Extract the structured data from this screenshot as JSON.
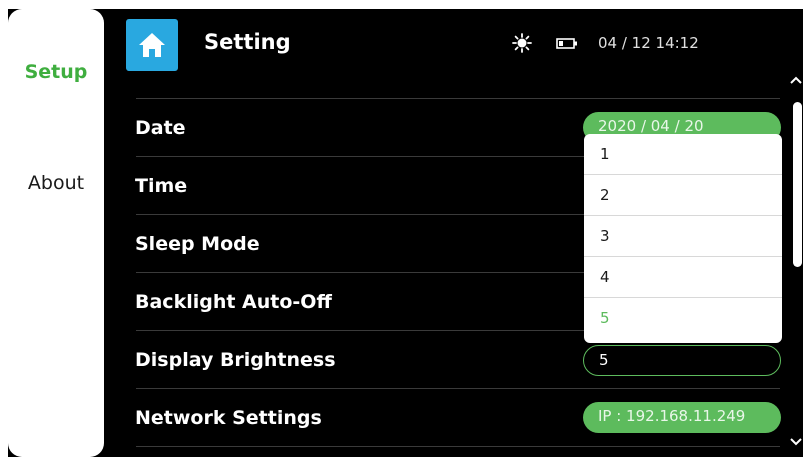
{
  "sidebar": {
    "items": [
      {
        "label": "Setup",
        "active": true
      },
      {
        "label": "About",
        "active": false
      }
    ]
  },
  "header": {
    "title": "Setting",
    "home_icon": "home-icon",
    "status_icons": [
      "brightness-icon",
      "battery-icon"
    ],
    "clock": "04 / 12  14:12"
  },
  "settings": {
    "rows": [
      {
        "label": "Date",
        "value": "2020 / 04 / 20"
      },
      {
        "label": "Time",
        "value": ""
      },
      {
        "label": "Sleep Mode",
        "value": ""
      },
      {
        "label": "Backlight Auto-Off",
        "value": ""
      },
      {
        "label": "Display Brightness",
        "value": "5"
      },
      {
        "label": "Network Settings",
        "value": "IP : 192.168.11.249"
      }
    ]
  },
  "dropdown": {
    "options": [
      "1",
      "2",
      "3",
      "4",
      "5"
    ],
    "selected": "5"
  },
  "colors": {
    "accent": "#5dbb5d",
    "active_tab": "#3fae3f",
    "home_button": "#29a8e0",
    "background": "#000000"
  }
}
